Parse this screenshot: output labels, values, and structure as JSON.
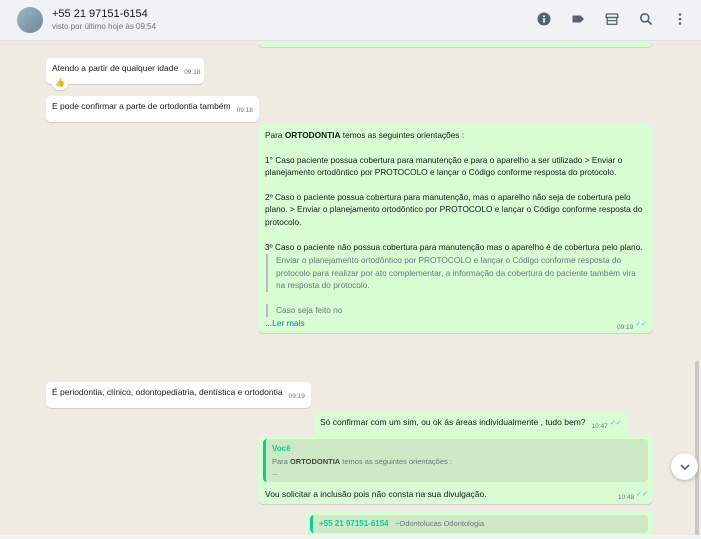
{
  "header": {
    "contact_name": "+55 21 97151-6154",
    "status": "visto por último hoje às 09:54",
    "icons": [
      "info-icon",
      "label-icon",
      "store-icon",
      "search-icon",
      "menu-icon"
    ]
  },
  "messages": {
    "m1": {
      "text": "Atendo a partir de  qualquer idade",
      "time": "09:18",
      "reaction": "👍"
    },
    "m2": {
      "text": "E pode confirmar a parte de ortodontia também",
      "time": "09:18"
    },
    "m3": {
      "intro_pre": "Para ",
      "intro_bold": "ORTODONTIA",
      "intro_post": " temos as seguintes orientações :",
      "p1": "1° Caso paciente possua cobertura para manutenção e para o aparelho a ser utilizado > Enviar o planejamento ortodôntico por PROTOCOLO e lançar o Código conforme resposta do protocolo.",
      "p2": "2º Caso o paciente possua cobertura para manutenção, mas o aparelho não seja de cobertura pelo plano. > Enviar o planejamento ortodôntico por PROTOCOLO e lançar o Código  conforme resposta do protocolo.",
      "p3": "3º Caso o paciente não possua cobertura para manutenção mas o aparelho é de cobertura pelo plano.",
      "quote1": "Enviar o planejamento ortodôntico por PROTOCOLO e lançar o Código conforme resposta do protocolo para realizar por ato complementar, a informação da cobertura do paciente também vira na resposta do protocolo.",
      "quote2": "Caso seja feito no",
      "read_more": "...Ler mais",
      "time": "09:19"
    },
    "m4": {
      "text": "É periodontia, clínico, odontopediatria, dentística e ortodontia",
      "time": "09:19"
    },
    "m5": {
      "text": "Só confirmar com um sim, ou ok ás áreas individualmente , tudo bem?",
      "time": "10:47"
    },
    "m6": {
      "reply_author": "Você",
      "reply_pre": "Para ",
      "reply_bold": "ORTODONTIA",
      "reply_post": " temos as seguintes orientações :",
      "reply_more": "...",
      "text": "Vou solicitar a inclusão pois não consta na sua divulgação.",
      "time": "10:48"
    },
    "m7": {
      "reply_author": "+55 21 97151-6154",
      "reply_sender": "~Odontolucas Odontologia"
    }
  },
  "colors": {
    "incoming": "#ffffff",
    "outgoing": "#d9fdd3",
    "accent": "#06cf9c",
    "link": "#027eb5",
    "read_ticks": "#53bdeb"
  }
}
